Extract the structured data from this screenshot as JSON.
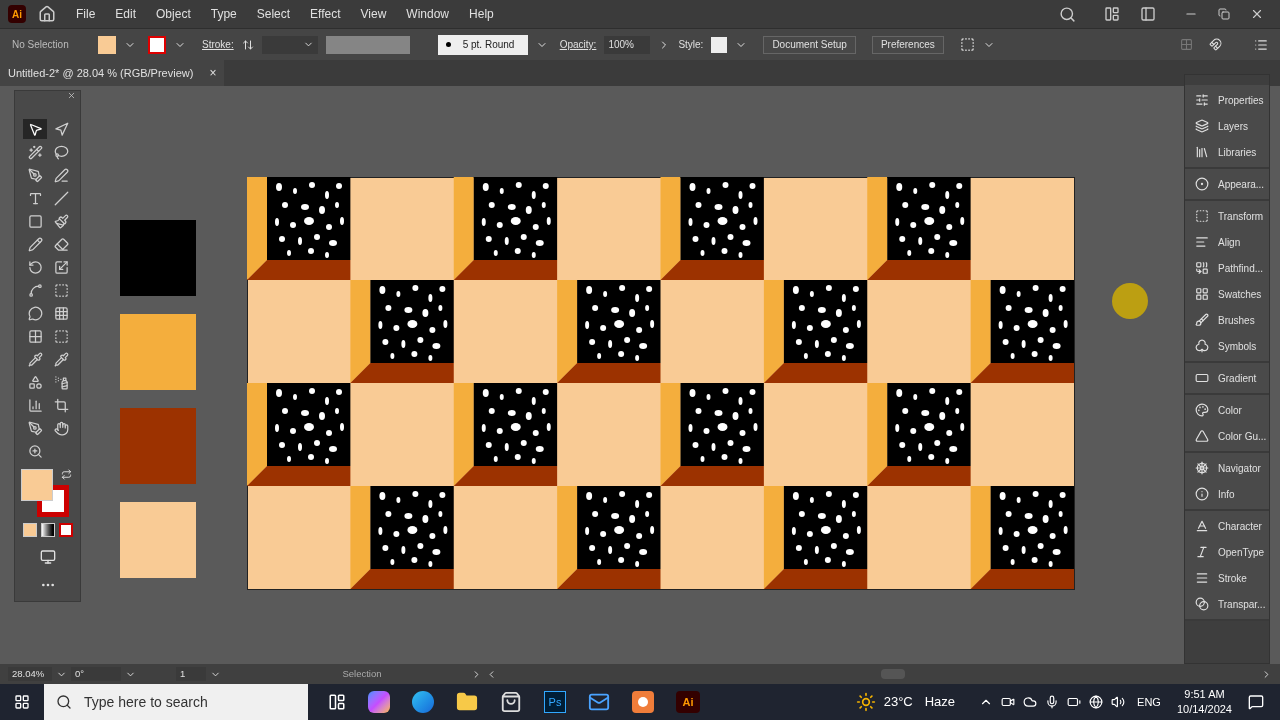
{
  "app_logo": "Ai",
  "menu": [
    "File",
    "Edit",
    "Object",
    "Type",
    "Select",
    "Effect",
    "View",
    "Window",
    "Help"
  ],
  "control_bar": {
    "selection": "No Selection",
    "stroke_label": "Stroke:",
    "brush": "5 pt. Round",
    "opacity_label": "Opacity:",
    "opacity": "100%",
    "style_label": "Style:",
    "buttons": [
      "Document Setup",
      "Preferences"
    ]
  },
  "document_tab": {
    "title": "Untitled-2* @ 28.04 % (RGB/Preview)",
    "close": "×"
  },
  "tools": [
    {
      "selected": true
    },
    {
      "selected": false
    },
    {
      "selected": false
    },
    {
      "selected": false
    },
    {
      "selected": false
    },
    {
      "selected": false
    },
    {
      "selected": false
    },
    {
      "selected": false
    },
    {
      "selected": false
    },
    {
      "selected": false
    },
    {
      "selected": false
    },
    {
      "selected": false
    },
    {
      "selected": false
    },
    {
      "selected": false
    },
    {
      "selected": false
    },
    {
      "selected": false
    },
    {
      "selected": false
    },
    {
      "selected": false
    },
    {
      "selected": false
    },
    {
      "selected": false
    },
    {
      "selected": false
    },
    {
      "selected": false
    },
    {
      "selected": false
    },
    {
      "selected": false
    },
    {
      "selected": false
    },
    {
      "selected": false
    },
    {
      "selected": false
    },
    {
      "selected": false
    },
    {
      "selected": false
    }
  ],
  "swatches": [
    {
      "color": "#000000"
    },
    {
      "color": "#f4ae3d"
    },
    {
      "color": "#9c3200"
    },
    {
      "color": "#f9cb95"
    }
  ],
  "panel_groups": [
    {
      "items": [
        "Properties",
        "Layers",
        "Libraries"
      ]
    },
    {
      "items": [
        "Appeara..."
      ]
    },
    {
      "items": [
        "Transform",
        "Align",
        "Pathfind...",
        "Swatches",
        "Brushes",
        "Symbols"
      ]
    },
    {
      "items": [
        "Gradient"
      ]
    },
    {
      "items": [
        "Color",
        "Color Gu..."
      ]
    },
    {
      "items": [
        "Navigator",
        "Info"
      ]
    },
    {
      "items": [
        "Character",
        "OpenType",
        "Stroke",
        "Transpar..."
      ]
    }
  ],
  "status_bar": {
    "zoom": "28.04%",
    "rotation": "0°",
    "artboard": "1",
    "tool": "Selection"
  },
  "taskbar": {
    "search_placeholder": "Type here to search",
    "ps_label": "Ps",
    "ai_label": "Ai",
    "temperature": "23°C",
    "weather": "Haze",
    "language": "ENG",
    "time": "9:51 AM",
    "date": "10/14/2024"
  }
}
